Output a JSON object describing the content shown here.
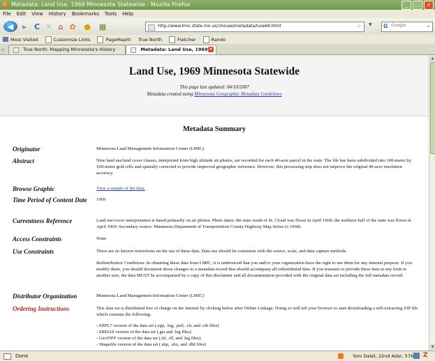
{
  "window": {
    "title": "Metadata: Land Use, 1969 Minnesota Statewide - Mozilla Firefox",
    "controls": [
      "_",
      "□",
      "×"
    ]
  },
  "menu": [
    "File",
    "Edit",
    "View",
    "History",
    "Bookmarks",
    "Tools",
    "Help"
  ],
  "nav": {
    "back": "◀",
    "forward": "▸",
    "reload": "C",
    "stop": "✕",
    "home": "⌂",
    "url": "http://www.lmic.state.mn.us/chouse/metadata/luse69.html",
    "star": "☆",
    "search_placeholder": "Google",
    "search_g": "G",
    "search_icon": "⌕",
    "dropdown": "▼",
    "topright": "⊞ ⌂"
  },
  "bookmarks": [
    "Most Visited",
    "Customize Links",
    "PageMapIt!",
    "True North",
    "Fletcher",
    "Rando"
  ],
  "tabs": [
    {
      "label": "True North: Mapping Minnesota's History"
    },
    {
      "label": "Metadata: Land Use, 1969 Minne..."
    }
  ],
  "page": {
    "title": "Land Use, 1969 Minnesota Statewide",
    "updated": "This page last updated: 04/10/2007",
    "created_prefix": "Metadata created using",
    "created_link": "Minnesota Geographic Metadata Guidelines",
    "summary_heading": "Metadata Summary",
    "sections": {
      "originator": {
        "label": "Originator",
        "value": "Minnesota Land Management Information Center (LMIC)"
      },
      "abstract": {
        "label": "Abstract",
        "value": "Nine land use/land cover classes, interpreted from high altitude air photos, are recorded for each 40-acre parcel in the state. The file has been subdivided into 100-meter by 100-meter grid cells and spatially corrected to provide improved geographic reference. However, this processing step does not improve the original 40-acre resolution accuracy."
      },
      "browse": {
        "label": "Browse Graphic",
        "link": "View a sample of the data."
      },
      "time_period": {
        "label": "Time Period of Content Date",
        "value": "1969"
      },
      "currentness": {
        "label": "Currentness Reference",
        "value": "Land use/cover interpretation is based primarily on air photos. Photo dates: the state south of St. Cloud was flown in April 1968; the northern half of the state was flown in April 1969. Secondary source: Minnesota Department of Transportation County Highway Map Series (c.1968)."
      },
      "access": {
        "label": "Access Constraints",
        "value": "None"
      },
      "use": {
        "label": "Use Constraints",
        "value": "There are no known restrictions on the use of these data. Data use should be consistent with the source, scale, and data capture methods.",
        "redistribution": "Redistribution Conditions: In obtaining these data from LMIC, it is understood that you and/or your organization have the right to use them for any internal purpose. If you modify them, you should document those changes in a metadata record that should accompany all redistributed data. If you transmit or provide these data in any form to another user, the data MUST be accompanied by a copy of this disclaimer and all documentation provided with the original data set including the full metadata record."
      },
      "distributor": {
        "label": "Distributor Organization",
        "value": "Minnesota Land Management Information Center (LMIC)"
      },
      "ordering": {
        "label": "Ordering Instructions",
        "value": "This data set is distributed free of charge on the internet by clicking below after Online Linkage. Doing so will tell your browser to start downloading a self-extracting ZIP file which contains the following:",
        "items": [
          "- EPPL7 version of the data set (.epp, .leg, .ped, .clr, and .ctb files)",
          "- ERDAS version of the data set (.gis and .leg files)",
          "- GeoTIFF version of the data set (.tif, .tfl, and .leg files)",
          "- Shapefile version of the data set (.shp, .shx, and .dbf files)"
        ]
      }
    }
  },
  "status": {
    "text": "Done",
    "date": "Yom Dalet, 22nd Adar, 5769",
    "zotero": "Z"
  }
}
